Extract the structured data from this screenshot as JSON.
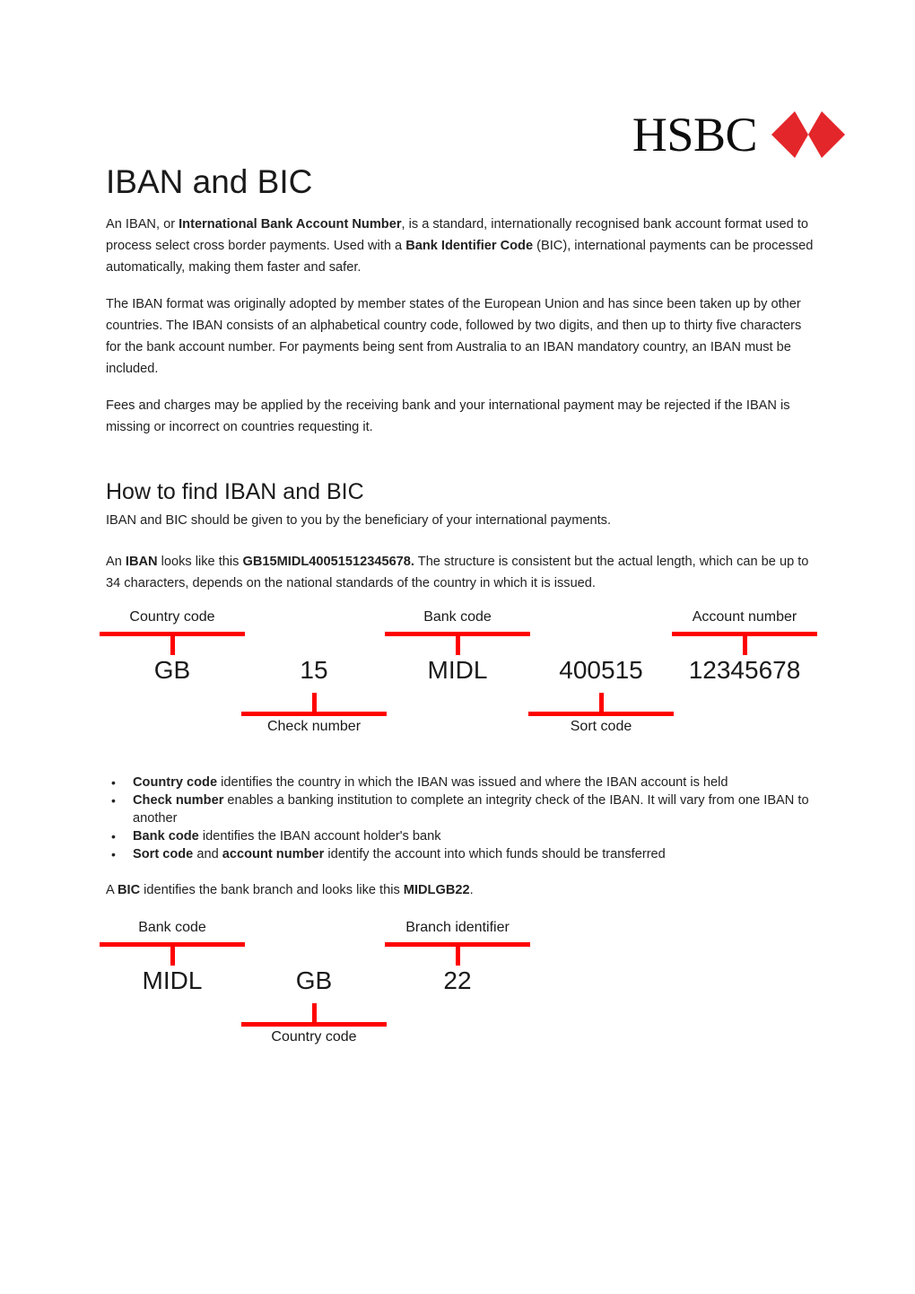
{
  "brand": {
    "logo_word": "HSBC",
    "logo_mark_name": "hsbc-hexagon-logo",
    "logo_red": "#e3262a",
    "accent_red": "#fe0000"
  },
  "document": {
    "title": "IBAN and BIC",
    "subheading": "How to find IBAN and BIC"
  },
  "paragraphs": {
    "intro": {
      "p1": "An IBAN, or ",
      "b1": "International Bank Account Number",
      "p2": ", is a standard, internationally recognised bank account format used to process select cross border payments. Used with a ",
      "b2": "Bank Identifier Code",
      "p3": " (BIC), international payments can be processed automatically, making them faster and safer."
    },
    "format": "The IBAN format was originally adopted by member states of the European Union and has since been taken up by other countries. The IBAN consists of an alphabetical country code, followed by two digits, and then up to thirty five characters for the bank account number. For payments being sent from Australia to an IBAN mandatory country, an IBAN must be included.",
    "fees": "Fees and charges may be applied by the receiving bank and your international payment may be rejected if the IBAN is missing or incorrect on countries requesting it.",
    "howto": "IBAN and BIC should be given to you by the beneficiary of your international payments.",
    "example": {
      "p1": "An ",
      "b1": "IBAN",
      "p2": " looks like this ",
      "b2": "GB15MIDL40051512345678.",
      "p3": " The structure is consistent but the actual length, which can be up to 34 characters, depends on the national standards of the country in which it is issued."
    },
    "bic": {
      "p1": "A ",
      "b1": "BIC",
      "p2": " identifies the bank branch and looks like this ",
      "b2": "MIDLGB22",
      "p3": "."
    }
  },
  "bullets": [
    {
      "marker": "•",
      "bold": "Country code",
      "rest": " identifies the country in which the IBAN was issued and where the IBAN account is held"
    },
    {
      "marker": "•",
      "bold": "Check number",
      "rest": " enables a banking institution to complete an integrity check of the IBAN. It will vary from one IBAN to another"
    },
    {
      "marker": "•",
      "bold": "Bank code",
      "rest": " identifies the IBAN account holder's bank"
    },
    {
      "marker": "•",
      "bold": "Sort code",
      "rest": " and ",
      "bold2": "account number",
      "rest2": " identify the account into which funds should be transferred"
    }
  ],
  "diagram_iban": {
    "name": "iban-structure-diagram",
    "full_value": "GB15MIDL40051512345678",
    "top_labels": [
      {
        "text": "Country code",
        "center": 192
      },
      {
        "text": "Bank code",
        "center": 510
      },
      {
        "text": "Account number",
        "center": 830
      }
    ],
    "values": [
      {
        "text": "GB",
        "center": 192
      },
      {
        "text": "15",
        "center": 350
      },
      {
        "text": "MIDL",
        "center": 510
      },
      {
        "text": "400515",
        "center": 670
      },
      {
        "text": "12345678",
        "center": 830
      }
    ],
    "bottom_labels": [
      {
        "text": "Check number",
        "center": 350
      },
      {
        "text": "Sort code",
        "center": 670
      }
    ]
  },
  "diagram_bic": {
    "name": "bic-structure-diagram",
    "full_value": "MIDLGB22",
    "top_labels": [
      {
        "text": "Bank code",
        "center": 192
      },
      {
        "text": "Branch identifier",
        "center": 510
      }
    ],
    "values": [
      {
        "text": "MIDL",
        "center": 192
      },
      {
        "text": "GB",
        "center": 350
      },
      {
        "text": "22",
        "center": 510
      }
    ],
    "bottom_labels": [
      {
        "text": "Country code",
        "center": 350
      }
    ]
  }
}
